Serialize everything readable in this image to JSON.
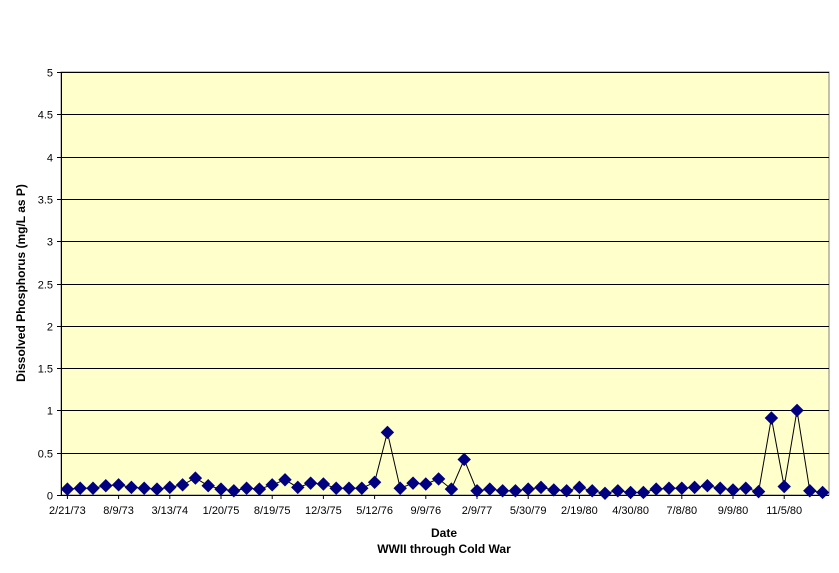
{
  "chart_data": {
    "type": "line",
    "title": "",
    "xlabel": "Date",
    "xlabel_sub": "WWII through Cold War",
    "ylabel": "Dissolved Phosphorus (mg/L as P)",
    "ylim": [
      0,
      5
    ],
    "yticks": [
      "0",
      "0.5",
      "1",
      "1.5",
      "2",
      "2.5",
      "3",
      "3.5",
      "4",
      "4.5",
      "5"
    ],
    "x_tick_labels": [
      "2/21/73",
      "8/9/73",
      "3/13/74",
      "1/20/75",
      "8/19/75",
      "12/3/75",
      "5/12/76",
      "9/9/76",
      "2/9/77",
      "5/30/79",
      "2/19/80",
      "4/30/80",
      "7/8/80",
      "9/9/80",
      "11/5/80"
    ],
    "grid": true,
    "legend": "none",
    "plot_background": "#ffffcc",
    "series_color": "#000080",
    "marker": "diamond",
    "series": [
      {
        "values": [
          0.07,
          0.08,
          0.08,
          0.11,
          0.12,
          0.09,
          0.08,
          0.07,
          0.09,
          0.12,
          0.2,
          0.11,
          0.07,
          0.05,
          0.08,
          0.07,
          0.12,
          0.18,
          0.09,
          0.14,
          0.13,
          0.08,
          0.08,
          0.08,
          0.15,
          0.74,
          0.08,
          0.14,
          0.13,
          0.19,
          0.07,
          0.42,
          0.05,
          0.07,
          0.05,
          0.05,
          0.07,
          0.09,
          0.06,
          0.05,
          0.09,
          0.05,
          0.02,
          0.05,
          0.03,
          0.03,
          0.07,
          0.08,
          0.08,
          0.09,
          0.11,
          0.08,
          0.06,
          0.08,
          0.04,
          0.91,
          0.1,
          1.0,
          0.05,
          0.03
        ]
      }
    ]
  }
}
